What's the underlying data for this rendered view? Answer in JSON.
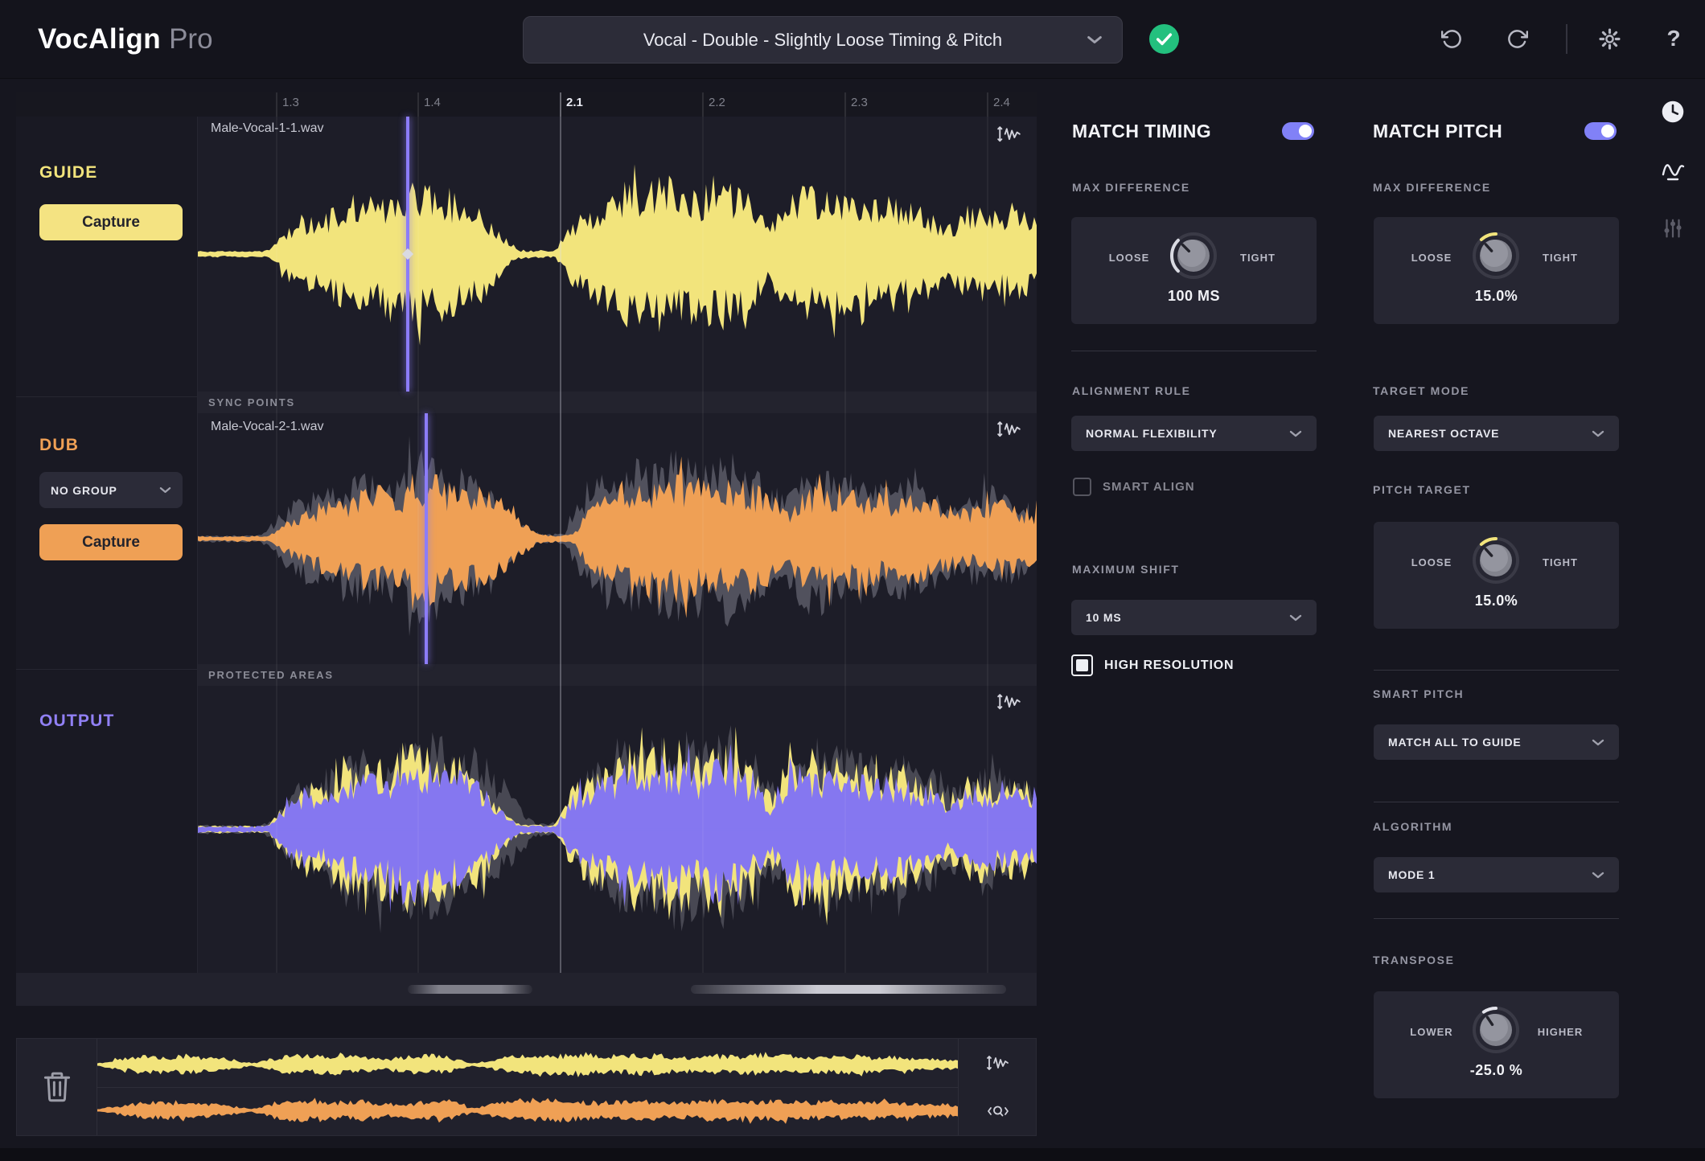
{
  "topbar": {
    "brand": "VocAlign",
    "brand_suffix": "Pro",
    "preset": "Vocal - Double - Slightly Loose Timing & Pitch",
    "help_label": "?"
  },
  "timeline": {
    "ticks": [
      "1.3",
      "1.4",
      "2.1",
      "2.2",
      "2.3",
      "2.4"
    ],
    "major_tick": "2.1"
  },
  "guide": {
    "label": "GUIDE",
    "capture_label": "Capture",
    "file": "Male-Vocal-1-1.wav"
  },
  "dub": {
    "label": "DUB",
    "group_value": "NO GROUP",
    "capture_label": "Capture",
    "file": "Male-Vocal-2-1.wav"
  },
  "output": {
    "label": "OUTPUT"
  },
  "strips": {
    "sync": "SYNC POINTS",
    "protected": "PROTECTED AREAS"
  },
  "timing": {
    "title": "MATCH TIMING",
    "max_difference_label": "MAX DIFFERENCE",
    "loose": "LOOSE",
    "tight": "TIGHT",
    "max_difference_value": "100 MS",
    "alignment_rule_label": "ALIGNMENT RULE",
    "alignment_rule_value": "NORMAL FLEXIBILITY",
    "smart_align_label": "SMART ALIGN",
    "maximum_shift_label": "MAXIMUM SHIFT",
    "maximum_shift_value": "10 MS",
    "high_resolution_label": "HIGH RESOLUTION"
  },
  "pitch": {
    "title": "MATCH PITCH",
    "max_difference_label": "MAX DIFFERENCE",
    "loose": "LOOSE",
    "tight": "TIGHT",
    "max_difference_value": "15.0%",
    "target_mode_label": "TARGET MODE",
    "target_mode_value": "NEAREST OCTAVE",
    "pitch_target_label": "PITCH TARGET",
    "pitch_target_value": "15.0%",
    "smart_pitch_label": "SMART PITCH",
    "smart_pitch_value": "MATCH ALL TO GUIDE",
    "algorithm_label": "ALGORITHM",
    "algorithm_value": "MODE 1",
    "transpose_label": "TRANSPOSE",
    "lower": "LOWER",
    "higher": "HIGHER",
    "transpose_value": "-25.0 %"
  },
  "toggles": {
    "match_timing_on": true,
    "match_pitch_on": true
  },
  "checkboxes": {
    "smart_align": false,
    "high_resolution": true
  },
  "knobs": {
    "timing_max_difference": {
      "arc_start": -135,
      "arc_end": -45,
      "pointer": -45,
      "arc_color": "#d9dae2"
    },
    "pitch_max_difference": {
      "arc_start": -42,
      "arc_end": 0,
      "pointer": -42,
      "arc_color": "#f2e47c"
    },
    "pitch_target": {
      "arc_start": -42,
      "arc_end": 0,
      "pointer": -42,
      "arc_color": "#f2e47c"
    },
    "transpose": {
      "arc_start": -34,
      "arc_end": 0,
      "pointer": -34,
      "arc_color": "#e4e4ec"
    }
  },
  "waveforms": {
    "colors": {
      "guide": "#f2e47c",
      "dub": "#efa055",
      "output": "#8577f0",
      "ghost": "#5b5b66",
      "output_ghost": "#54545e",
      "playhead": "#8c7cf8"
    },
    "guide_file_env": [
      0.04,
      0.04,
      0.04,
      0.04,
      0.05,
      0.35,
      0.5,
      0.45,
      0.65,
      0.75,
      0.7,
      0.85,
      0.95,
      0.85,
      0.8,
      0.75,
      0.6,
      0.25,
      0.06,
      0.05,
      0.05,
      0.45,
      0.6,
      0.7,
      0.9,
      0.8,
      0.95,
      0.9,
      0.8,
      0.95,
      0.85,
      0.7,
      0.35,
      0.75,
      0.85,
      0.8,
      0.75,
      0.7,
      0.65,
      0.7,
      0.6,
      0.55,
      0.35,
      0.55,
      0.6,
      0.5,
      0.55,
      0.45
    ],
    "dub_file_env": [
      0.04,
      0.04,
      0.04,
      0.04,
      0.04,
      0.25,
      0.45,
      0.5,
      0.55,
      0.7,
      0.75,
      0.65,
      0.8,
      0.9,
      0.8,
      0.75,
      0.7,
      0.55,
      0.3,
      0.08,
      0.05,
      0.06,
      0.5,
      0.65,
      0.75,
      0.85,
      0.75,
      0.9,
      0.85,
      0.75,
      0.9,
      0.8,
      0.65,
      0.4,
      0.7,
      0.8,
      0.75,
      0.7,
      0.65,
      0.6,
      0.65,
      0.55,
      0.5,
      0.4,
      0.5,
      0.55,
      0.45,
      0.4
    ],
    "overview_guide_env": [
      0.06,
      0.3,
      0.45,
      0.35,
      0.5,
      0.4,
      0.3,
      0.06,
      0.35,
      0.5,
      0.45,
      0.55,
      0.4,
      0.3,
      0.45,
      0.5,
      0.4,
      0.06,
      0.3,
      0.45,
      0.55,
      0.5,
      0.6,
      0.45,
      0.5,
      0.55,
      0.45,
      0.4,
      0.5,
      0.45,
      0.55,
      0.5,
      0.4,
      0.45,
      0.5,
      0.4,
      0.45,
      0.35,
      0.3,
      0.25
    ],
    "overview_dub_env": [
      0.05,
      0.25,
      0.4,
      0.45,
      0.5,
      0.35,
      0.25,
      0.08,
      0.4,
      0.55,
      0.5,
      0.45,
      0.5,
      0.35,
      0.4,
      0.45,
      0.5,
      0.1,
      0.35,
      0.5,
      0.6,
      0.55,
      0.5,
      0.4,
      0.55,
      0.5,
      0.4,
      0.45,
      0.55,
      0.5,
      0.45,
      0.55,
      0.45,
      0.5,
      0.45,
      0.5,
      0.4,
      0.45,
      0.35,
      0.3
    ]
  }
}
